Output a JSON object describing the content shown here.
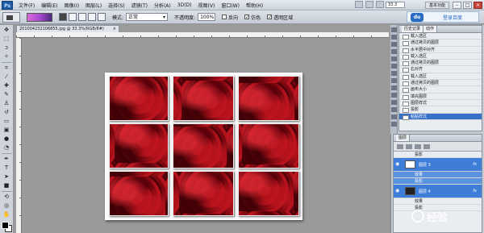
{
  "app": {
    "logo_text": "Ps"
  },
  "menu": [
    "文件(F)",
    "编辑(E)",
    "图像(I)",
    "图层(L)",
    "选择(S)",
    "滤镜(T)",
    "分析(A)",
    "3D(D)",
    "视图(V)",
    "窗口(W)",
    "帮助(H)"
  ],
  "zoom": "33.3",
  "workspace": {
    "label": "基本功能"
  },
  "options": {
    "mode_label": "模式:",
    "mode_value": "正常",
    "opacity_label": "不透明度:",
    "opacity_value": "100%",
    "reverse_label": "反向",
    "dither_label": "仿色",
    "transparency_label": "透明区域"
  },
  "login": {
    "label": "登录百度"
  },
  "document": {
    "tab_title": "201004232106855.jpg @ 33.3%(RGB/8#)"
  },
  "history": {
    "tabs": [
      "历史记录",
      "动作"
    ],
    "items": [
      "载入选区",
      "通过拷贝的图层",
      "水平居中对齐",
      "载入选区",
      "通过拷贝的图层",
      "右对齐",
      "载入选区",
      "通过拷贝的图层",
      "画布大小",
      "填充图层",
      "图层样式",
      "投影",
      "粘贴样式"
    ],
    "active_index": 12
  },
  "layers": {
    "tab": "图层",
    "rows": [
      {
        "type": "effect",
        "label": "投影"
      },
      {
        "type": "layer",
        "label": "图层 3",
        "thumb": "light",
        "fx": "fx",
        "selected": true
      },
      {
        "type": "effect",
        "label": "效果"
      },
      {
        "type": "effect",
        "label": "投影"
      },
      {
        "type": "layer",
        "label": "图层 4",
        "thumb": "dark",
        "fx": "fx",
        "selected": true
      },
      {
        "type": "effect",
        "label": "效果"
      },
      {
        "type": "effect",
        "label": "投影"
      }
    ]
  },
  "watermark": {
    "text": "经验"
  },
  "colors": {
    "accent": "#3670c9",
    "rose": "#8b0a14",
    "canvas_bg": "#9a9a9a"
  }
}
